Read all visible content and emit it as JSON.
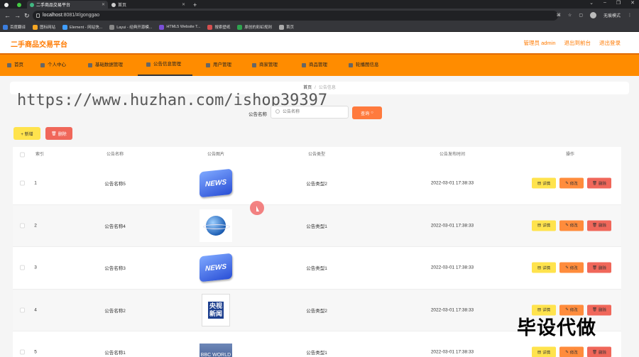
{
  "browser": {
    "tabs": [
      {
        "label": ""
      },
      {
        "label": ""
      },
      {
        "label": "二手商品交易平台"
      },
      {
        "label": "首页"
      }
    ],
    "url_host": "localhost",
    "url_rest": ":8081/#/gonggao",
    "profile_label": "无痕模式",
    "bookmarks": [
      "百度翻译",
      "图标网站",
      "Element - 网站快...",
      "Layui - 经典开源模...",
      "HTML5 Website T...",
      "搜索壁纸",
      "原创的彩虹规则",
      "首页"
    ]
  },
  "header": {
    "title": "二手商品交易平台",
    "admin_link": "管理员 admin",
    "back_link": "退出到前台",
    "logout_link": "退出登录"
  },
  "nav": {
    "items": [
      {
        "label": "首页"
      },
      {
        "label": "个人中心"
      },
      {
        "label": "基础数据管理"
      },
      {
        "label": "公告信息管理"
      },
      {
        "label": "用户管理"
      },
      {
        "label": "商家管理"
      },
      {
        "label": "商品管理"
      },
      {
        "label": "轮播图信息"
      }
    ]
  },
  "breadcrumb": {
    "home": "首页",
    "separator": "/",
    "current": "公告信息"
  },
  "watermark": "https://www.huzhan.com/ishop39397",
  "search": {
    "label": "公告名称",
    "placeholder": "公告名称",
    "button": "查询"
  },
  "toolbar": {
    "add": "+ 新增",
    "delete": "删除"
  },
  "table": {
    "headers": {
      "index": "索引",
      "name": "公告名称",
      "image": "公告图片",
      "type": "公告类型",
      "time": "公告发布时间",
      "actions": "操作"
    },
    "rows": [
      {
        "index": "1",
        "name": "公告名称5",
        "image": "NEWS",
        "type": "公告类型2",
        "time": "2022-03-01 17:38:33"
      },
      {
        "index": "2",
        "name": "公告名称4",
        "image": "",
        "type": "公告类型1",
        "time": "2022-03-01 17:38:33"
      },
      {
        "index": "3",
        "name": "公告名称3",
        "image": "NEWS",
        "type": "公告类型1",
        "time": "2022-03-01 17:38:33"
      },
      {
        "index": "4",
        "name": "公告名称2",
        "image": "央视新闻",
        "type": "公告类型2",
        "time": "2022-03-01 17:38:33"
      },
      {
        "index": "5",
        "name": "公告名称1",
        "image": "BBC WORLD",
        "type": "公告类型1",
        "time": "2022-03-01 17:38:33"
      }
    ],
    "action_labels": {
      "detail": "详情",
      "edit": "修改",
      "delete": "删除"
    }
  },
  "stamp_text": "毕设代做",
  "colors": {
    "accent": "#ff8c00",
    "title": "#ff7a00",
    "query": "#ff7a3d",
    "add": "#ffe34d",
    "delete": "#f0675a"
  }
}
